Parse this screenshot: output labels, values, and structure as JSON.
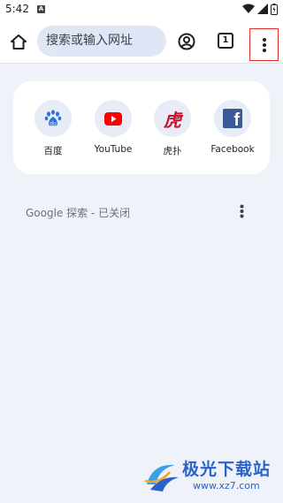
{
  "status_bar": {
    "time": "5:42",
    "notification_badge": "A"
  },
  "toolbar": {
    "omnibox_placeholder": "搜索或输入网址",
    "tab_count": "1"
  },
  "shortcuts": [
    {
      "label": "百度",
      "icon": "baidu-icon"
    },
    {
      "label": "YouTube",
      "icon": "youtube-icon"
    },
    {
      "label": "虎扑",
      "icon": "hupu-icon",
      "glyph": "虎"
    },
    {
      "label": "Facebook",
      "icon": "facebook-icon",
      "glyph": "f"
    }
  ],
  "discover": {
    "label": "Google 探索 - 已关闭"
  },
  "watermark": {
    "title": "极光下载站",
    "url": "www.xz7.com"
  },
  "colors": {
    "background": "#f0f2fa",
    "omnibox": "#dfe6f6",
    "highlight_border": "#e0302a",
    "youtube_red": "#ff0000",
    "facebook_blue": "#3b5998",
    "baidu_blue": "#2d6fe0",
    "hupu_red": "#c8102e"
  }
}
